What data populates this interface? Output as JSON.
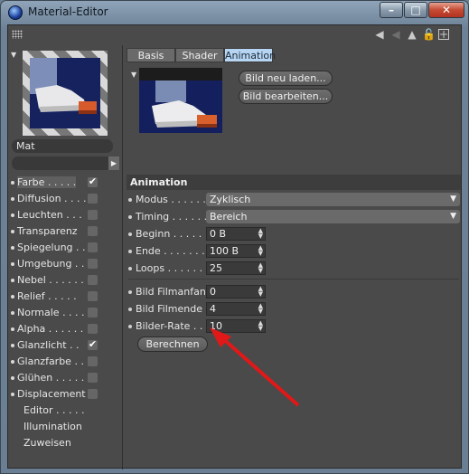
{
  "window": {
    "title": "Material-Editor"
  },
  "toolbar": {
    "icons": [
      "grip-icon",
      "back-icon",
      "forward-icon",
      "up-icon",
      "lock-icon",
      "new-window-icon"
    ]
  },
  "material": {
    "name": "Mat"
  },
  "channels": [
    {
      "label": "Farbe . . . . .",
      "checked": true,
      "has_checkbox": true,
      "active": true
    },
    {
      "label": "Diffusion . . . .",
      "checked": false,
      "has_checkbox": true
    },
    {
      "label": "Leuchten . . .",
      "checked": false,
      "has_checkbox": true
    },
    {
      "label": "Transparenz",
      "checked": false,
      "has_checkbox": true
    },
    {
      "label": "Spiegelung . .",
      "checked": false,
      "has_checkbox": true
    },
    {
      "label": "Umgebung . .",
      "checked": false,
      "has_checkbox": true
    },
    {
      "label": "Nebel . . . . . .",
      "checked": false,
      "has_checkbox": true
    },
    {
      "label": "Relief . . . . .",
      "checked": false,
      "has_checkbox": true
    },
    {
      "label": "Normale . . . .",
      "checked": false,
      "has_checkbox": true
    },
    {
      "label": "Alpha . . . . . .",
      "checked": false,
      "has_checkbox": true
    },
    {
      "label": "Glanzlicht . .",
      "checked": true,
      "has_checkbox": true
    },
    {
      "label": "Glanzfarbe . . .",
      "checked": false,
      "has_checkbox": true
    },
    {
      "label": "Glühen . . . . .",
      "checked": false,
      "has_checkbox": true
    },
    {
      "label": "Displacement",
      "checked": false,
      "has_checkbox": true
    },
    {
      "label": "Editor . . . . .",
      "has_checkbox": false
    },
    {
      "label": "Illumination",
      "has_checkbox": false
    },
    {
      "label": "Zuweisen",
      "has_checkbox": false
    }
  ],
  "tabs": {
    "basis": "Basis",
    "shader": "Shader",
    "animation": "Animation"
  },
  "buttons": {
    "reload": "Bild neu laden...",
    "edit": "Bild bearbeiten...",
    "calculate": "Berechnen"
  },
  "section": {
    "title": "Animation"
  },
  "fields": {
    "modus": {
      "label": "Modus . . . . . .",
      "value": "Zyklisch"
    },
    "timing": {
      "label": "Timing . . . . . .",
      "value": "Bereich"
    },
    "beginn": {
      "label": "Beginn . . . . .",
      "value": "0 B"
    },
    "ende": {
      "label": "Ende . . . . . . .",
      "value": "100 B"
    },
    "loops": {
      "label": "Loops . . . . . . .",
      "value": "25"
    },
    "filmanfang": {
      "label": "Bild Filmanfang",
      "value": "0"
    },
    "filmende": {
      "label": "Bild Filmende",
      "value": "4"
    },
    "rate": {
      "label": "Bilder-Rate . . .",
      "value": "10"
    }
  },
  "colors": {
    "accent_tab": "#b6d5f2",
    "annotation_arrow": "#e01818",
    "panel_bg": "#4a4a4a"
  }
}
